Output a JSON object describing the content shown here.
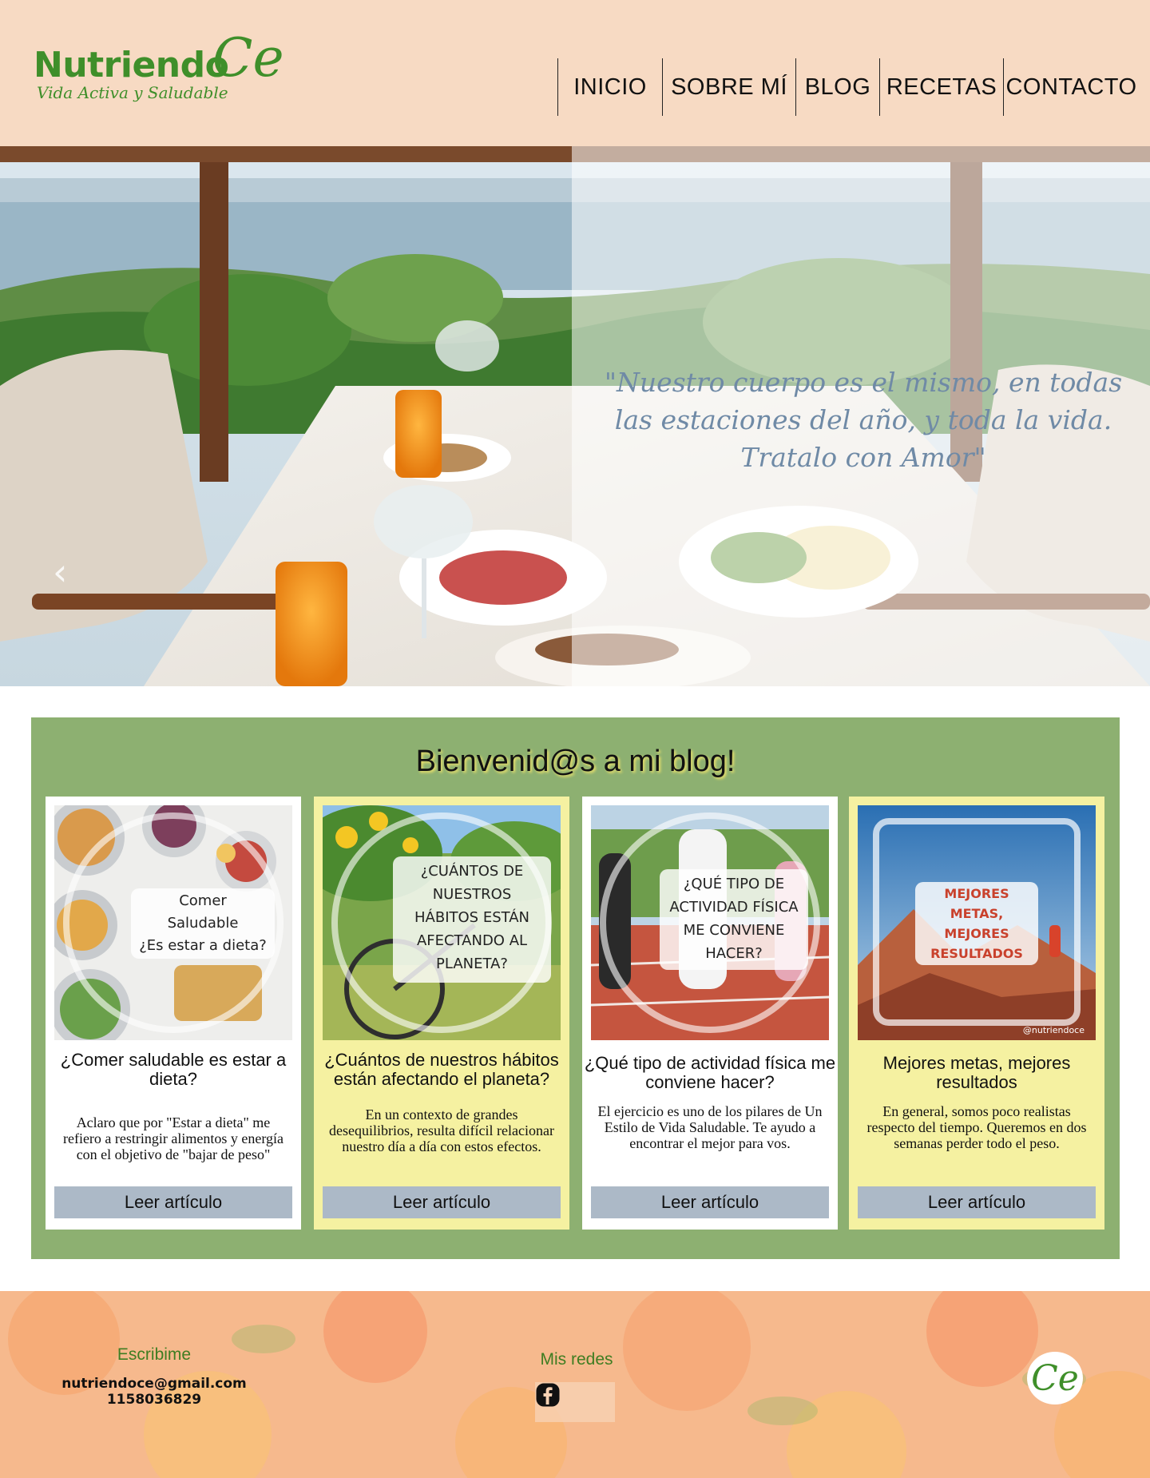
{
  "brand": {
    "name": "Nutriendo",
    "mark": "Ce",
    "tagline": "Vida Activa y Saludable",
    "color": "#3f8f2a"
  },
  "nav": {
    "items": [
      "INICIO",
      "SOBRE MÍ",
      "BLOG",
      "RECETAS",
      "CONTACTO"
    ]
  },
  "hero": {
    "quote": "\"Nuestro cuerpo es el mismo, en todas las estaciones del año, y toda la vida. Tratalo con Amor\"",
    "prev_icon": "chevron-left-icon"
  },
  "blog": {
    "title": "Bienvenid@s a mi blog!",
    "background": "#8db071",
    "cards": [
      {
        "image_label_lines": [
          "Comer",
          "Saludable",
          "¿Es estar a dieta?"
        ],
        "title": "¿Comer saludable es estar a dieta?",
        "text": "Aclaro que por \"Estar a dieta\" me refiero a restringir alimentos y energía con el objetivo de \"bajar de peso\"",
        "button": "Leer artículo"
      },
      {
        "image_label_lines": [
          "¿CUÁNTOS DE",
          "NUESTROS",
          "HÁBITOS ESTÁN",
          "AFECTANDO AL",
          "PLANETA?"
        ],
        "title": "¿Cuántos de nuestros hábitos están afectando el planeta?",
        "text": "En un contexto de grandes desequilibrios, resulta difícil relacionar nuestro día a día con estos efectos.",
        "button": "Leer artículo"
      },
      {
        "image_label_lines": [
          "¿QUÉ TIPO DE",
          "ACTIVIDAD FÍSICA",
          "ME CONVIENE",
          "HACER?"
        ],
        "title": "¿Qué tipo de actividad física me conviene hacer?",
        "text": "El ejercicio es uno de los pilares de Un Estilo de Vida Saludable. Te ayudo a encontrar el mejor para vos.",
        "button": "Leer artículo"
      },
      {
        "image_label_lines": [
          "MEJORES",
          "METAS,",
          "MEJORES",
          "RESULTADOS"
        ],
        "image_handle": "@nutriendoce",
        "title": "Mejores metas, mejores resultados",
        "text": "En general, somos poco realistas respecto del tiempo. Queremos en dos semanas perder todo el peso.",
        "button": "Leer artículo"
      }
    ]
  },
  "footer": {
    "contact_title": "Escribime",
    "email": "nutriendoce@gmail.com",
    "phone": "1158036829",
    "social_title": "Mis redes",
    "social_icons": [
      "instagram-icon",
      "facebook-icon"
    ],
    "logo_mark": "Ce"
  }
}
